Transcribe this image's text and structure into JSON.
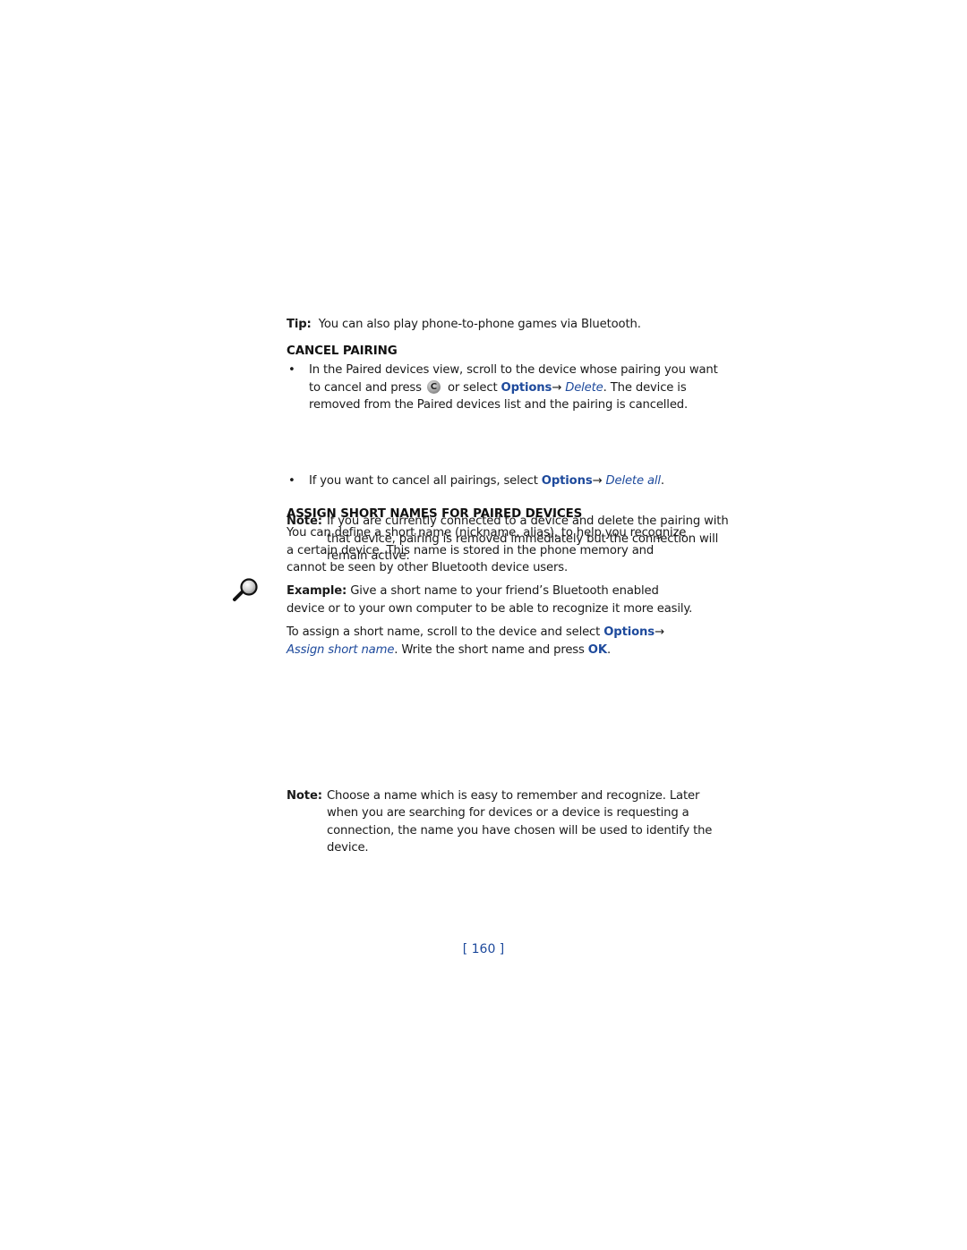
{
  "tip": {
    "label": "Tip:",
    "text": "You can also play phone-to-phone games via Bluetooth."
  },
  "cancel_pairing": {
    "heading": "CANCEL PAIRING",
    "bullet1": {
      "text_a": "In the Paired devices view, scroll to the device whose pairing you want to cancel and press",
      "icon": "c-key-icon",
      "text_b": "or select",
      "options": "Options",
      "arrow": "→",
      "delete": "Delete",
      "text_c": ". The device is removed from the Paired devices list and the pairing is cancelled."
    },
    "bullet2": {
      "text_a": "If you want to cancel all pairings, select",
      "options": "Options",
      "arrow": "→",
      "delete_all": "Delete all",
      "text_b": "."
    },
    "note": {
      "label": "Note:",
      "text": "If you are currently connected to a device and delete the pairing with that device, pairing is removed immediately but the connection will remain active."
    }
  },
  "assign_short_names": {
    "heading": "ASSIGN SHORT NAMES FOR PAIRED DEVICES",
    "intro": "You can define a short name (nickname, alias), to help you recognize a certain device. This name is stored in the phone memory and cannot be seen by other Bluetooth device users.",
    "example": {
      "icon": "magnifier-icon",
      "label": "Example:",
      "text": "Give a short name to your friend’s Bluetooth enabled device or to your own computer to be able to recognize it more easily."
    },
    "instruction": {
      "text_a": "To assign a short name, scroll to the device and select",
      "options": "Options",
      "arrow": "→",
      "assign": "Assign short name",
      "text_b": ". Write the short name and press",
      "ok": "OK",
      "text_c": "."
    },
    "note": {
      "label": "Note:",
      "text": "Choose a name which is easy to remember and recognize. Later when you are searching for devices or a device is requesting a connection, the name you have chosen will be used to identify the device."
    }
  },
  "page_number": "[ 160 ]",
  "colors": {
    "link_blue": "#1e4a9c",
    "text": "#1a1a1a"
  }
}
